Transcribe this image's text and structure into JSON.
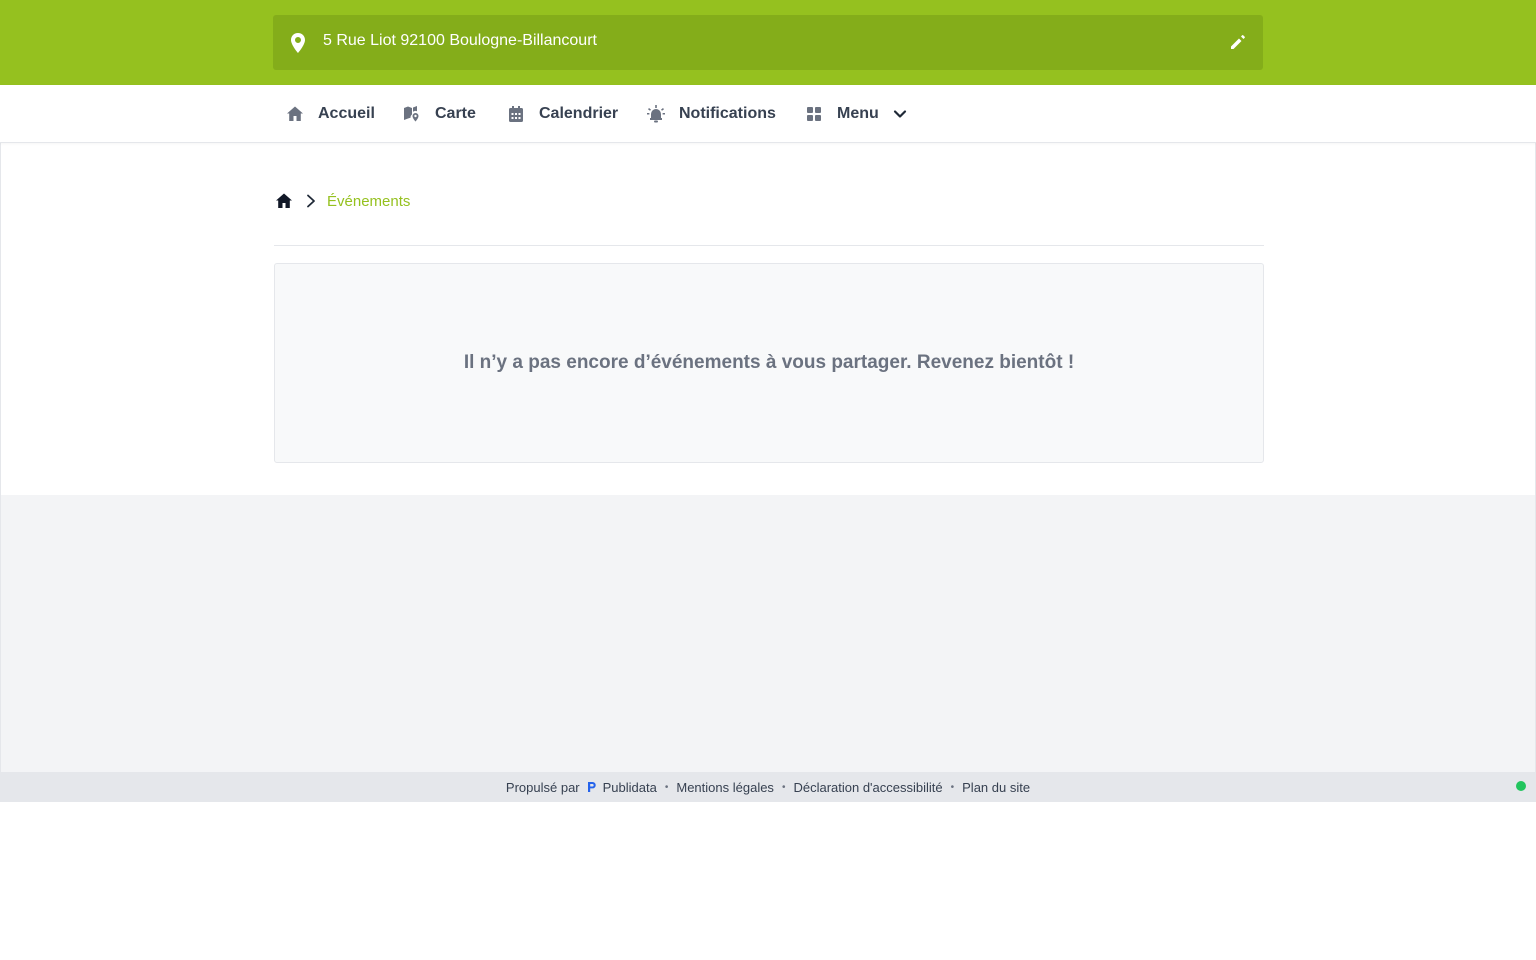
{
  "header": {
    "address": "5 Rue Liot 92100 Boulogne-Billancourt",
    "accent_color": "#95c11f"
  },
  "nav": {
    "items": [
      {
        "label": "Accueil",
        "icon": "home-icon"
      },
      {
        "label": "Carte",
        "icon": "map-marker-icon"
      },
      {
        "label": "Calendrier",
        "icon": "calendar-icon"
      },
      {
        "label": "Notifications",
        "icon": "alarm-bell-icon"
      },
      {
        "label": "Menu",
        "icon": "grid-icon"
      }
    ]
  },
  "breadcrumb": {
    "current": "Événements"
  },
  "main": {
    "empty_message": "Il n’y a pas encore d’événements à vous partager. Revenez bientôt !"
  },
  "footer": {
    "powered_by": "Propulsé par",
    "brand": "Publidata",
    "links": [
      "Mentions légales",
      "Déclaration d'accessibilité",
      "Plan du site"
    ],
    "status_color": "#22c55e"
  }
}
